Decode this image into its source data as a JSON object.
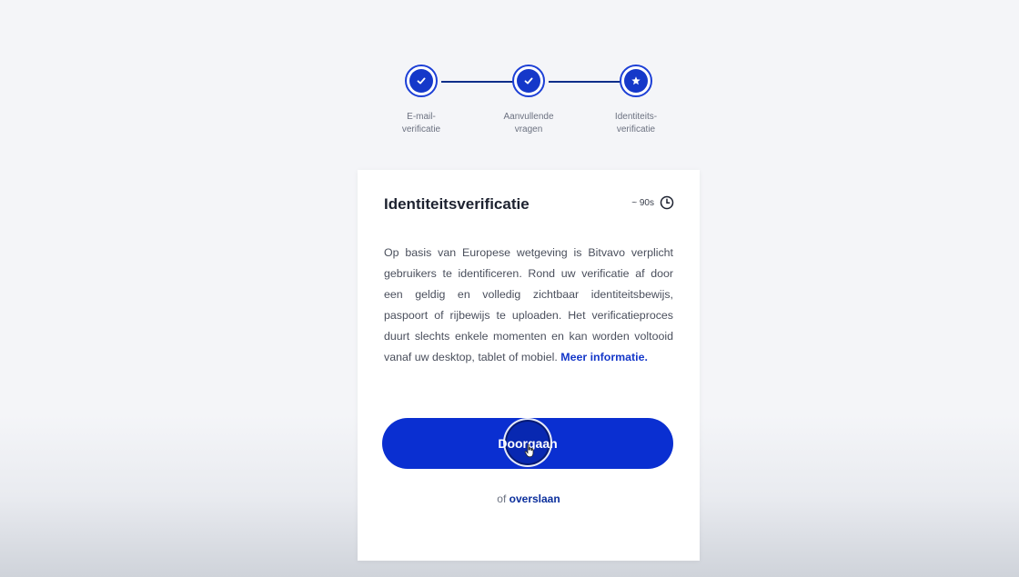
{
  "stepper": {
    "steps": [
      {
        "line1": "E-mail-",
        "line2": "verificatie",
        "state": "done",
        "icon": "check-icon"
      },
      {
        "line1": "Aanvullende",
        "line2": "vragen",
        "state": "done",
        "icon": "check-icon"
      },
      {
        "line1": "Identiteits-",
        "line2": "verificatie",
        "state": "current",
        "icon": "star-icon"
      }
    ]
  },
  "card": {
    "title": "Identiteitsverificatie",
    "duration": "~ 90s",
    "body": "Op basis van Europese wetgeving is Bitvavo verplicht gebruikers te identificeren. Rond uw verificatie af door een geldig en volledig zichtbaar identiteitsbewijs, paspoort of rijbewijs te uploaden. Het verificatieproces duurt slechts enkele momenten en kan worden voltooid vanaf uw desktop, tablet of mobiel.",
    "more_link": "Meer informatie.",
    "continue_label": "Doorgaan",
    "skip_prefix": "of",
    "skip_link": "overslaan"
  },
  "colors": {
    "accent": "#0a2fd1",
    "step": "#1538c9",
    "line": "#0a2e8a",
    "link": "#1538c9"
  }
}
